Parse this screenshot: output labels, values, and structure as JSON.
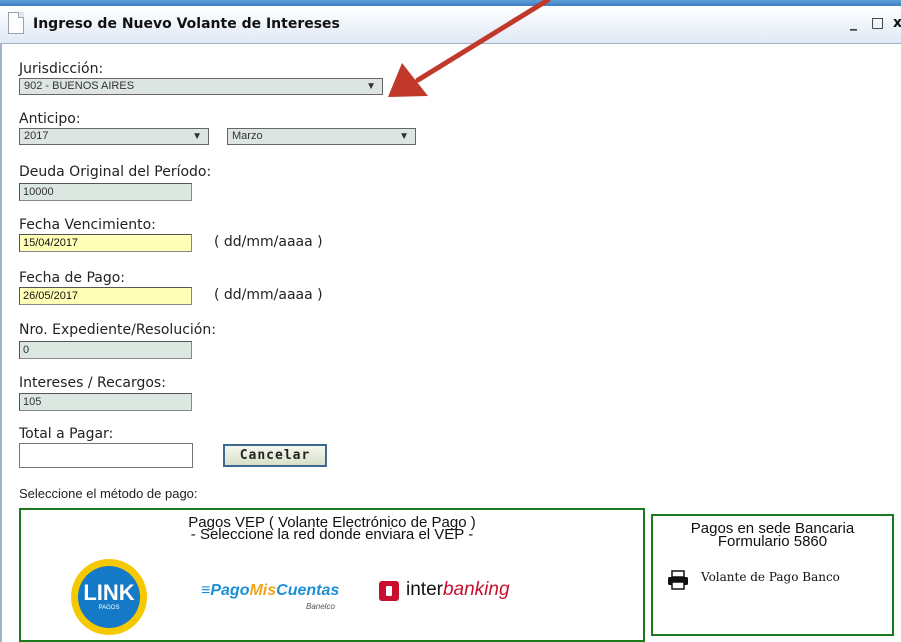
{
  "window": {
    "title": "Ingreso de Nuevo Volante de Intereses",
    "minimize": "_",
    "maximize": "□",
    "close": "x"
  },
  "form": {
    "jurisdiccion": {
      "label": "Jurisdicción:",
      "value": "902 - BUENOS AIRES"
    },
    "anticipo": {
      "label": "Anticipo:",
      "year": "2017",
      "month": "Marzo"
    },
    "deuda": {
      "label": "Deuda Original del Período:",
      "value": "10000"
    },
    "fecha_venc": {
      "label": "Fecha Vencimiento:",
      "value": "15/04/2017",
      "hint": "( dd/mm/aaaa )"
    },
    "fecha_pago": {
      "label": "Fecha de Pago:",
      "value": "26/05/2017",
      "hint": "( dd/mm/aaaa )"
    },
    "expediente": {
      "label": "Nro. Expediente/Resolución:",
      "value": "0"
    },
    "intereses": {
      "label": "Intereses / Recargos:",
      "value": "105"
    },
    "total": {
      "label": "Total a Pagar:",
      "value": ""
    },
    "cancel_label": "Cancelar"
  },
  "payment": {
    "prompt": "Seleccione el método de pago:",
    "vep": {
      "line1": "Pagos VEP ( Volante Electrónico de Pago )",
      "line2": "- Seleccione la red donde enviara el VEP -",
      "networks": {
        "link": {
          "name": "LINK",
          "sub": "PAGOS"
        },
        "pmc": {
          "prefix": "Pago",
          "mid": "Mis",
          "suffix": "Cuentas",
          "sub": "Banelco"
        },
        "interbanking": {
          "a": "inter",
          "b": "banking"
        }
      }
    },
    "bank": {
      "line1": "Pagos en sede Bancaria",
      "line2": "Formulario 5860",
      "link_label": "Volante de Pago Banco"
    }
  },
  "colors": {
    "box_border": "#1b7a1b",
    "arrow": "#c0392b",
    "date_field_bg": "#ffffb8"
  },
  "icons": [
    "document-icon",
    "printer-icon",
    "dropdown-arrow-icon",
    "annotation-arrow"
  ]
}
